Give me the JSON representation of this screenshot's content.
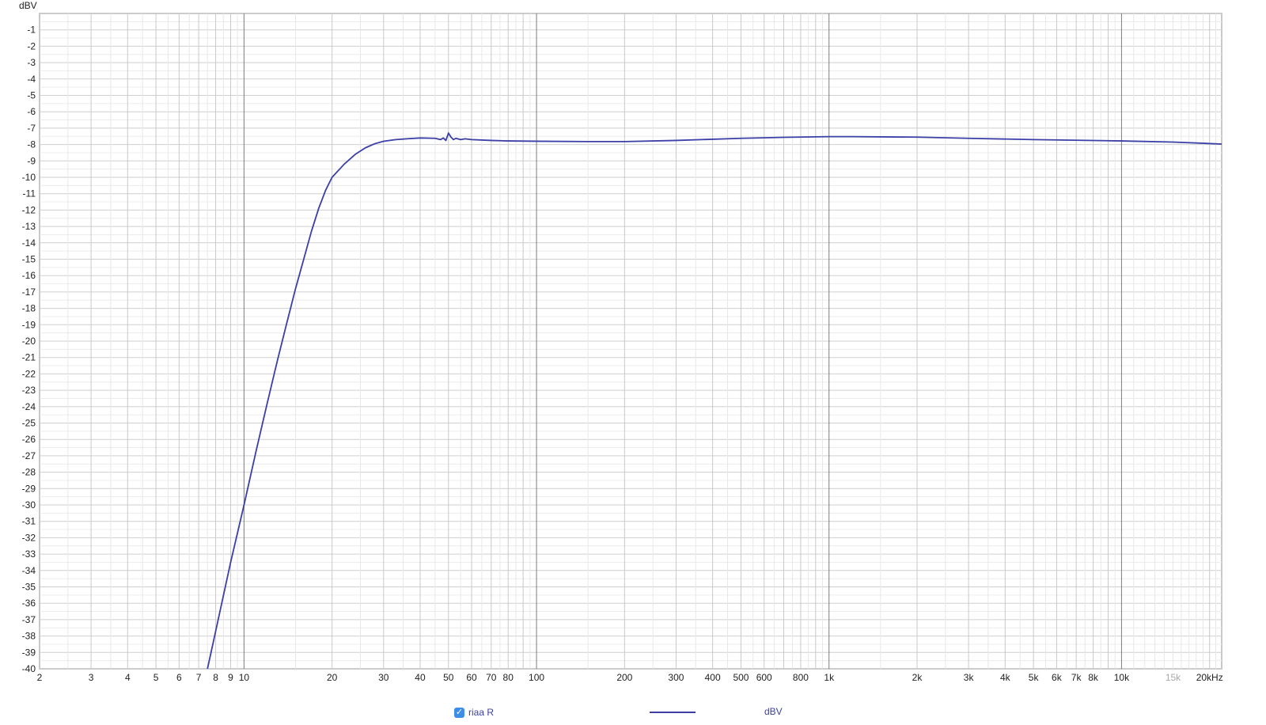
{
  "chart_data": {
    "type": "line",
    "ylabel": "dBV",
    "xunit": "Hz",
    "x_scale": "log",
    "xlim": [
      2,
      22000
    ],
    "ylim": [
      -40,
      0
    ],
    "grid": true,
    "y_ticks": [
      -1,
      -2,
      -3,
      -4,
      -5,
      -6,
      -7,
      -8,
      -9,
      -10,
      -11,
      -12,
      -13,
      -14,
      -15,
      -16,
      -17,
      -18,
      -19,
      -20,
      -21,
      -22,
      -23,
      -24,
      -25,
      -26,
      -27,
      -28,
      -29,
      -30,
      -31,
      -32,
      -33,
      -34,
      -35,
      -36,
      -37,
      -38,
      -39,
      -40
    ],
    "x_ticks": [
      {
        "value": 2,
        "label": "2"
      },
      {
        "value": 3,
        "label": "3"
      },
      {
        "value": 4,
        "label": "4"
      },
      {
        "value": 5,
        "label": "5"
      },
      {
        "value": 6,
        "label": "6"
      },
      {
        "value": 7,
        "label": "7"
      },
      {
        "value": 8,
        "label": "8"
      },
      {
        "value": 9,
        "label": "9"
      },
      {
        "value": 10,
        "label": "10"
      },
      {
        "value": 20,
        "label": "20"
      },
      {
        "value": 30,
        "label": "30"
      },
      {
        "value": 40,
        "label": "40"
      },
      {
        "value": 50,
        "label": "50"
      },
      {
        "value": 60,
        "label": "60"
      },
      {
        "value": 70,
        "label": "70"
      },
      {
        "value": 80,
        "label": "80"
      },
      {
        "value": 100,
        "label": "100"
      },
      {
        "value": 200,
        "label": "200"
      },
      {
        "value": 300,
        "label": "300"
      },
      {
        "value": 400,
        "label": "400"
      },
      {
        "value": 500,
        "label": "500"
      },
      {
        "value": 600,
        "label": "600"
      },
      {
        "value": 800,
        "label": "800"
      },
      {
        "value": 1000,
        "label": "1k"
      },
      {
        "value": 2000,
        "label": "2k"
      },
      {
        "value": 3000,
        "label": "3k"
      },
      {
        "value": 4000,
        "label": "4k"
      },
      {
        "value": 5000,
        "label": "5k"
      },
      {
        "value": 6000,
        "label": "6k"
      },
      {
        "value": 7000,
        "label": "7k"
      },
      {
        "value": 8000,
        "label": "8k"
      },
      {
        "value": 10000,
        "label": "10k"
      },
      {
        "value": 15000,
        "label": "15k"
      },
      {
        "value": 20000,
        "label": "20kHz"
      }
    ],
    "series": [
      {
        "name": "riaa R",
        "color": "#3b3fa6",
        "x": [
          7.5,
          8,
          9,
          10,
          11,
          12,
          13,
          14,
          15,
          16,
          17,
          18,
          19,
          20,
          22,
          24,
          26,
          28,
          30,
          33,
          36,
          40,
          45,
          47,
          48,
          49,
          50,
          51,
          52,
          53,
          55,
          57,
          60,
          70,
          80,
          100,
          150,
          200,
          300,
          500,
          700,
          1000,
          1200,
          2000,
          3000,
          5000,
          10000,
          15000,
          22000
        ],
        "y": [
          -40,
          -37.7,
          -33.5,
          -30,
          -26.7,
          -23.8,
          -21.2,
          -18.9,
          -16.8,
          -15,
          -13.3,
          -11.9,
          -10.8,
          -10,
          -9.2,
          -8.6,
          -8.2,
          -7.95,
          -7.8,
          -7.7,
          -7.65,
          -7.6,
          -7.62,
          -7.7,
          -7.6,
          -7.75,
          -7.3,
          -7.55,
          -7.7,
          -7.62,
          -7.7,
          -7.65,
          -7.7,
          -7.75,
          -7.78,
          -7.8,
          -7.82,
          -7.82,
          -7.75,
          -7.62,
          -7.56,
          -7.52,
          -7.52,
          -7.55,
          -7.62,
          -7.7,
          -7.78,
          -7.85,
          -7.97
        ]
      }
    ]
  },
  "legend": {
    "checkbox_mark": "✓",
    "series_label": "riaa R",
    "unit_label": "dBV"
  }
}
